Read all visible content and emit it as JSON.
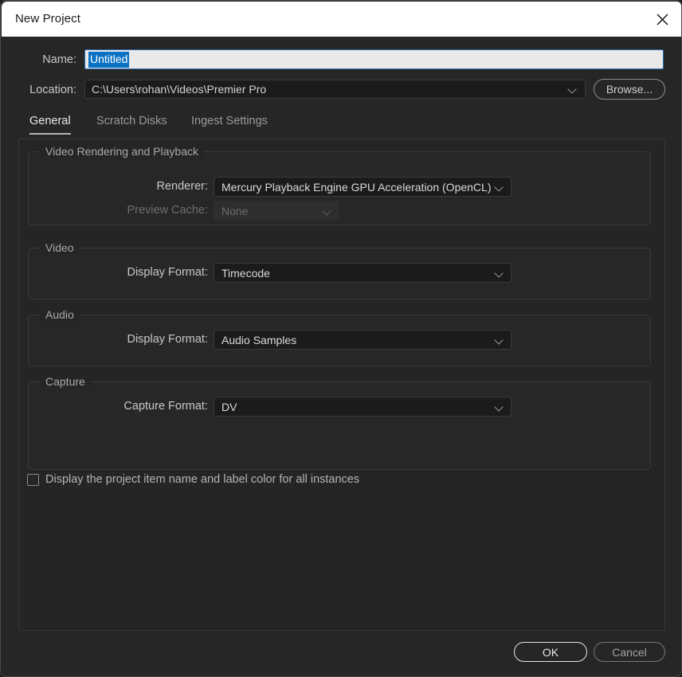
{
  "window": {
    "title": "New Project",
    "close_icon": "close-icon"
  },
  "header": {
    "name_label": "Name:",
    "name_value": "Untitled",
    "location_label": "Location:",
    "location_value": "C:\\Users\\rohan\\Videos\\Premier Pro",
    "browse_label": "Browse...",
    "selection_color": "#0a72c4"
  },
  "tabs": [
    {
      "label": "General",
      "active": true
    },
    {
      "label": "Scratch Disks",
      "active": false
    },
    {
      "label": "Ingest Settings",
      "active": false
    }
  ],
  "groups": {
    "video_rendering": {
      "title": "Video Rendering and Playback",
      "renderer_label": "Renderer:",
      "renderer_value": "Mercury Playback Engine GPU Acceleration (OpenCL)",
      "preview_cache_label": "Preview Cache:",
      "preview_cache_value": "None"
    },
    "video": {
      "title": "Video",
      "display_format_label": "Display Format:",
      "display_format_value": "Timecode"
    },
    "audio": {
      "title": "Audio",
      "display_format_label": "Display Format:",
      "display_format_value": "Audio Samples"
    },
    "capture": {
      "title": "Capture",
      "capture_format_label": "Capture Format:",
      "capture_format_value": "DV"
    }
  },
  "options": {
    "display_project_item_name": "Display the project item name and label color for all instances",
    "display_project_item_checked": false
  },
  "footer": {
    "ok_label": "OK",
    "cancel_label": "Cancel"
  }
}
